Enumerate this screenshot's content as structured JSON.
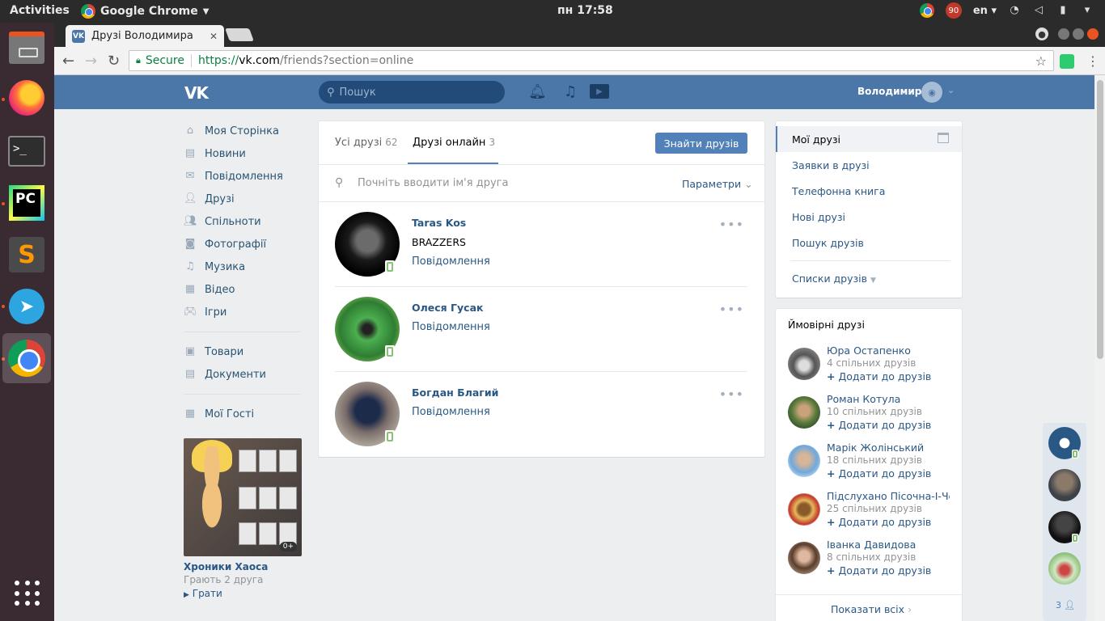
{
  "system": {
    "activities": "Activities",
    "app_menu": "Google Chrome",
    "clock": "пн 17:58",
    "notif_count": "90",
    "keyboard": "en"
  },
  "browser": {
    "tab_title": "Друзі Володимира",
    "secure_label": "Secure",
    "url_scheme": "https://",
    "url_host": "vk.com",
    "url_path": "/friends?section=online"
  },
  "vk": {
    "logo": "VK",
    "search_placeholder": "Пошук",
    "user_name": "Володимир",
    "left_menu": [
      {
        "label": "Моя Сторінка",
        "icon": "home-icon"
      },
      {
        "label": "Новини",
        "icon": "news-icon"
      },
      {
        "label": "Повідомлення",
        "icon": "messages-icon"
      },
      {
        "label": "Друзі",
        "icon": "friends-icon"
      },
      {
        "label": "Спільноти",
        "icon": "groups-icon"
      },
      {
        "label": "Фотографії",
        "icon": "photos-icon"
      },
      {
        "label": "Музика",
        "icon": "music-icon"
      },
      {
        "label": "Відео",
        "icon": "video-icon"
      },
      {
        "label": "Ігри",
        "icon": "games-icon"
      }
    ],
    "left_menu_2": [
      {
        "label": "Товари",
        "icon": "market-icon"
      },
      {
        "label": "Документи",
        "icon": "docs-icon"
      }
    ],
    "left_menu_3": [
      {
        "label": "Мої Гості",
        "icon": "guests-icon"
      }
    ],
    "game": {
      "badge": "0+",
      "title": "Хроники Хаоса",
      "subtitle": "Грають 2 друга",
      "play": "Грати"
    },
    "tabs": {
      "all_label": "Усі друзі",
      "all_count": "62",
      "online_label": "Друзі онлайн",
      "online_count": "3",
      "find_button": "Знайти друзів"
    },
    "search": {
      "placeholder": "Почніть вводити ім'я друга",
      "params": "Параметри"
    },
    "friends": [
      {
        "name": "Taras Kos",
        "status": "BRAZZERS",
        "message": "Повідомлення"
      },
      {
        "name": "Олеся Гусак",
        "status": "",
        "message": "Повідомлення"
      },
      {
        "name": "Богдан Благий",
        "status": "",
        "message": "Повідомлення"
      }
    ],
    "right_menu": {
      "items": [
        "Мої друзі",
        "Заявки в друзі",
        "Телефонна книга",
        "Нові друзі",
        "Пошук друзів"
      ],
      "lists": "Списки друзів"
    },
    "possible": {
      "title": "Ймовірні друзі",
      "people": [
        {
          "name": "Юра Остапенко",
          "common": "4 спільних друзів"
        },
        {
          "name": "Роман Котула",
          "common": "10 спільних друзів"
        },
        {
          "name": "Марік Жолінський",
          "common": "18 спільних друзів"
        },
        {
          "name": "Підслухано Пісочна-І-Че...",
          "common": "25 спільних друзів"
        },
        {
          "name": "Іванка Давидова",
          "common": "8 спільних друзів"
        }
      ],
      "add_label": "Додати до друзів",
      "show_all": "Показати всіх"
    },
    "chat_count": "3"
  }
}
